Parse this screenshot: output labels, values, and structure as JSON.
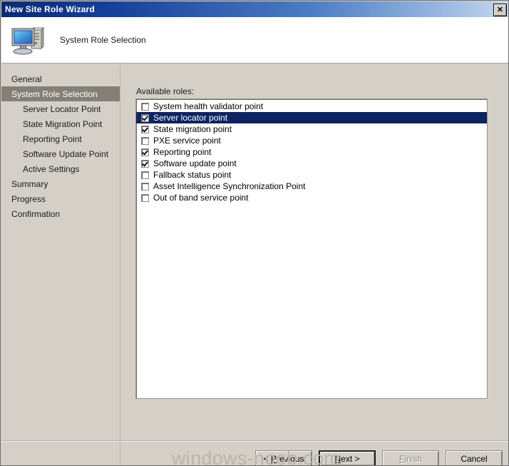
{
  "window": {
    "title": "New Site Role Wizard",
    "close_label": "✕"
  },
  "header": {
    "title": "System Role Selection",
    "icon": "computer-icon"
  },
  "sidebar": {
    "items": [
      {
        "label": "General",
        "level": 0,
        "selected": false
      },
      {
        "label": "System Role Selection",
        "level": 0,
        "selected": true
      },
      {
        "label": "Server Locator Point",
        "level": 1,
        "selected": false
      },
      {
        "label": "State Migration Point",
        "level": 1,
        "selected": false
      },
      {
        "label": "Reporting Point",
        "level": 1,
        "selected": false
      },
      {
        "label": "Software Update Point",
        "level": 1,
        "selected": false
      },
      {
        "label": "Active Settings",
        "level": 1,
        "selected": false
      },
      {
        "label": "Summary",
        "level": 0,
        "selected": false
      },
      {
        "label": "Progress",
        "level": 0,
        "selected": false
      },
      {
        "label": "Confirmation",
        "level": 0,
        "selected": false
      }
    ]
  },
  "content": {
    "roles_label": "Available roles:",
    "roles": [
      {
        "label": "System health validator point",
        "checked": false,
        "selected": false
      },
      {
        "label": "Server locator point",
        "checked": true,
        "selected": true
      },
      {
        "label": "State migration point",
        "checked": true,
        "selected": false
      },
      {
        "label": "PXE service point",
        "checked": false,
        "selected": false
      },
      {
        "label": "Reporting point",
        "checked": true,
        "selected": false
      },
      {
        "label": "Software update point",
        "checked": true,
        "selected": false
      },
      {
        "label": "Fallback status point",
        "checked": false,
        "selected": false
      },
      {
        "label": "Asset Intelligence Synchronization Point",
        "checked": false,
        "selected": false
      },
      {
        "label": "Out of band service point",
        "checked": false,
        "selected": false
      }
    ]
  },
  "footer": {
    "buttons": [
      {
        "name": "previous",
        "prefix": "< ",
        "accel": "P",
        "suffix": "revious",
        "state": "enabled"
      },
      {
        "name": "next",
        "prefix": "",
        "accel": "N",
        "suffix": "ext >",
        "state": "default"
      },
      {
        "name": "finish",
        "prefix": "",
        "accel": "F",
        "suffix": "inish",
        "state": "disabled"
      },
      {
        "name": "cancel",
        "prefix": "",
        "accel": "",
        "suffix": "Cancel",
        "state": "enabled"
      }
    ]
  },
  "watermark": {
    "text": "windows-noob.com"
  },
  "colors": {
    "titlebar_dark": "#0a2a72",
    "titlebar_light": "#c6d9ef",
    "dialog_face": "#d4d0c8",
    "selection_blue": "#0e2361",
    "nav_selected": "#848076",
    "watermark": "#b9b5ad"
  }
}
